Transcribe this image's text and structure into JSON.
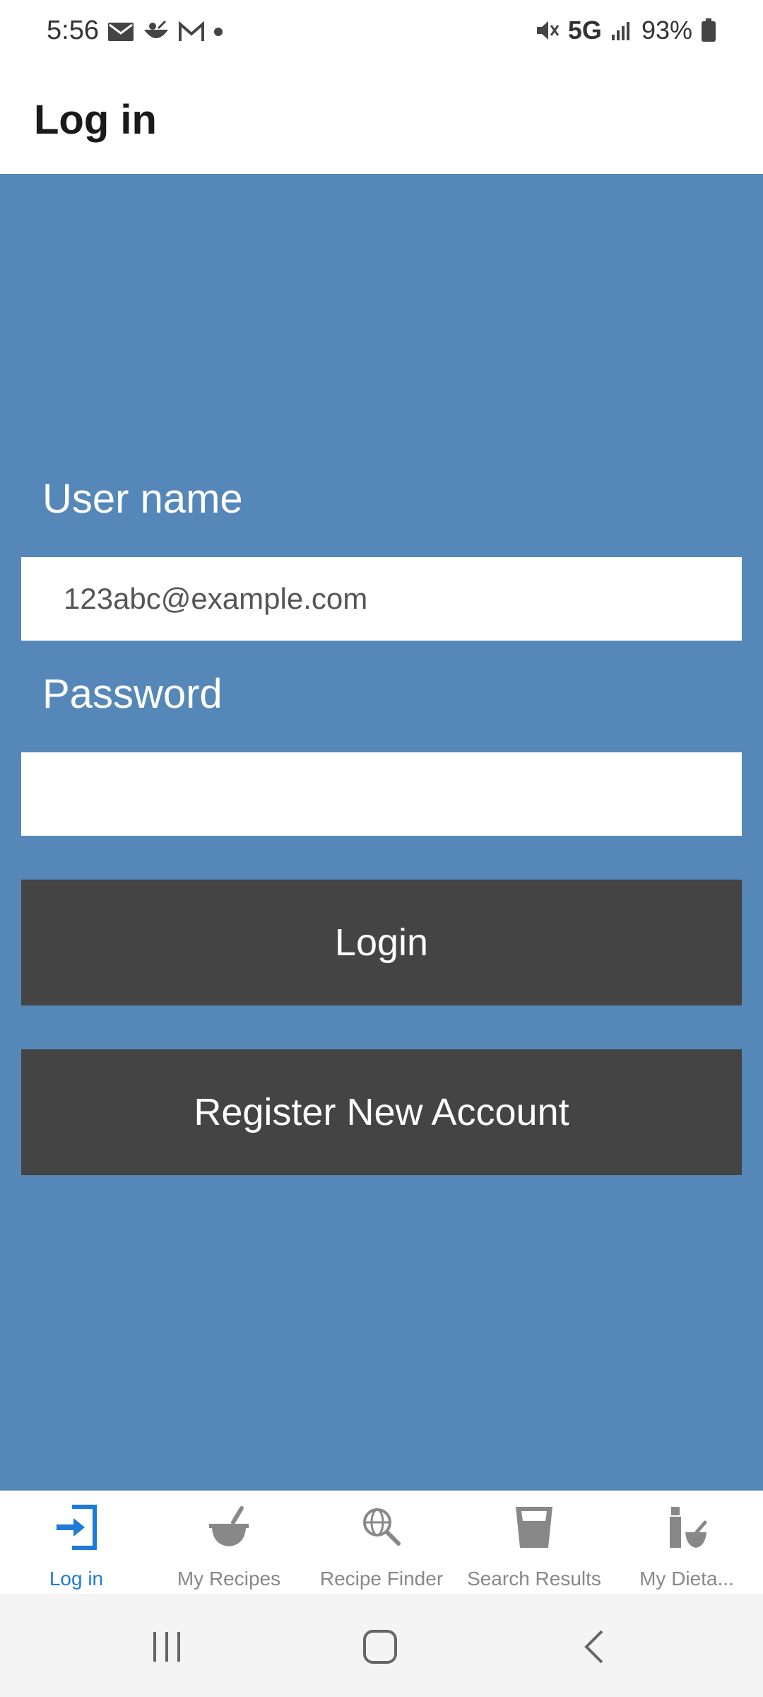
{
  "status_bar": {
    "time": "5:56",
    "network": "5G",
    "battery": "93%",
    "icons": [
      "mail-icon",
      "cooking-app-icon",
      "gmail-icon",
      "dot-icon",
      "mute-icon",
      "signal-icon",
      "battery-icon"
    ]
  },
  "header": {
    "title": "Log in"
  },
  "form": {
    "username_label": "User name",
    "username_value": "123abc@example.com",
    "password_label": "Password",
    "password_value": "",
    "login_button": "Login",
    "register_button": "Register New Account"
  },
  "tabs": [
    {
      "label": "Log in",
      "icon": "login-icon",
      "active": true
    },
    {
      "label": "My Recipes",
      "icon": "mortar-pestle-icon",
      "active": false
    },
    {
      "label": "Recipe Finder",
      "icon": "globe-search-icon",
      "active": false
    },
    {
      "label": "Search Results",
      "icon": "glass-icon",
      "active": false
    },
    {
      "label": "My Dieta...",
      "icon": "bottle-bowl-icon",
      "active": false
    }
  ],
  "colors": {
    "main_bg": "#5588b9",
    "button_bg": "#444444",
    "active_tab": "#1e7bd6",
    "inactive_tab": "#888888"
  }
}
